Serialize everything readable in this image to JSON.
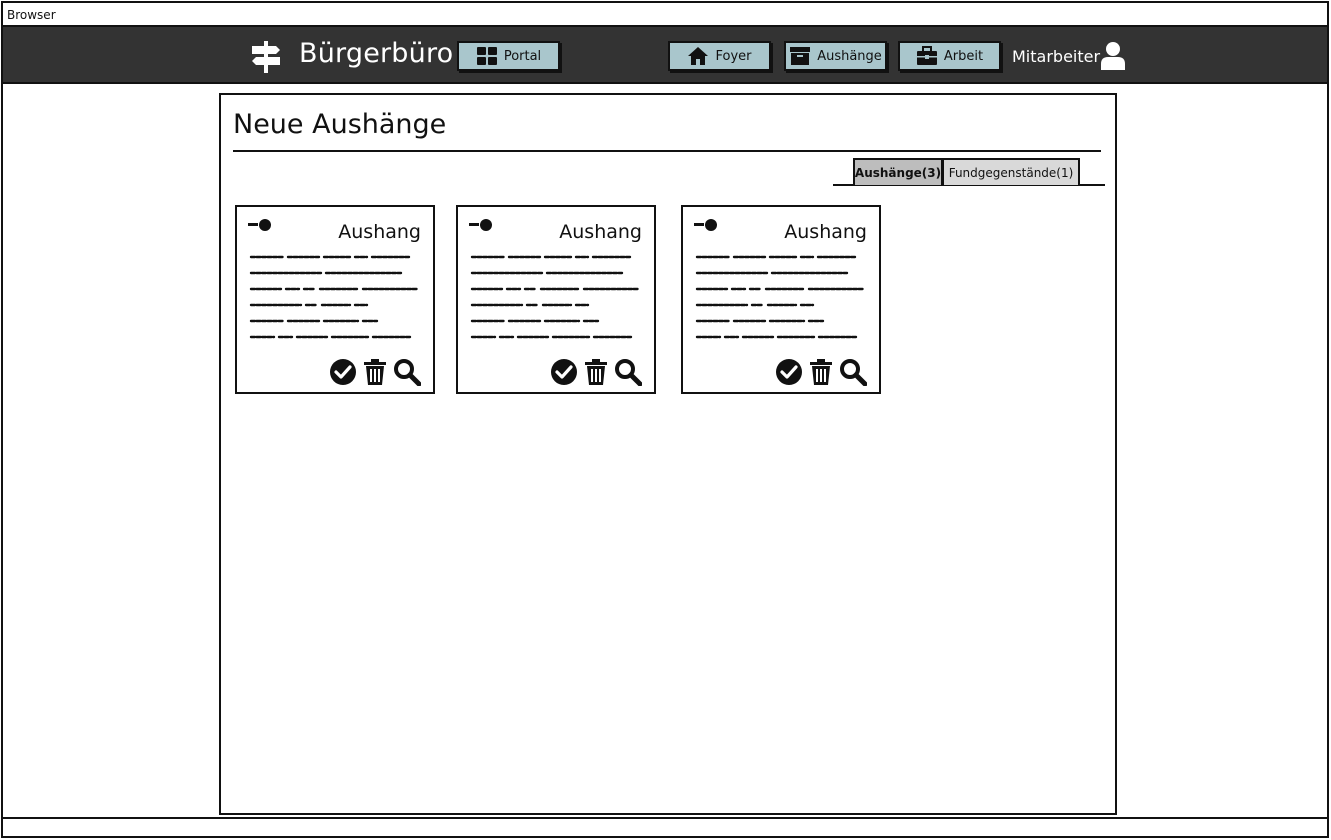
{
  "browser": {
    "title": "Browser"
  },
  "nav": {
    "brand": "Bürgerbüro",
    "portal_label": "Portal",
    "foyer_label": "Foyer",
    "aushaenge_label": "Aushänge",
    "arbeit_label": "Arbeit",
    "user_label": "Mitarbeiter",
    "button_color": "#a9c6cc",
    "bar_color": "#333333"
  },
  "page": {
    "title": "Neue Aushänge",
    "tabs": [
      {
        "label": "Aushänge(3)",
        "active": true
      },
      {
        "label": "Fundgegenstände(1)",
        "active": false
      }
    ]
  },
  "cards": [
    {
      "title": "Aushang",
      "icons": [
        "pin-icon",
        "check-icon",
        "trash-icon",
        "search-icon"
      ]
    },
    {
      "title": "Aushang",
      "icons": [
        "pin-icon",
        "check-icon",
        "trash-icon",
        "search-icon"
      ]
    },
    {
      "title": "Aushang",
      "icons": [
        "pin-icon",
        "check-icon",
        "trash-icon",
        "search-icon"
      ]
    }
  ]
}
